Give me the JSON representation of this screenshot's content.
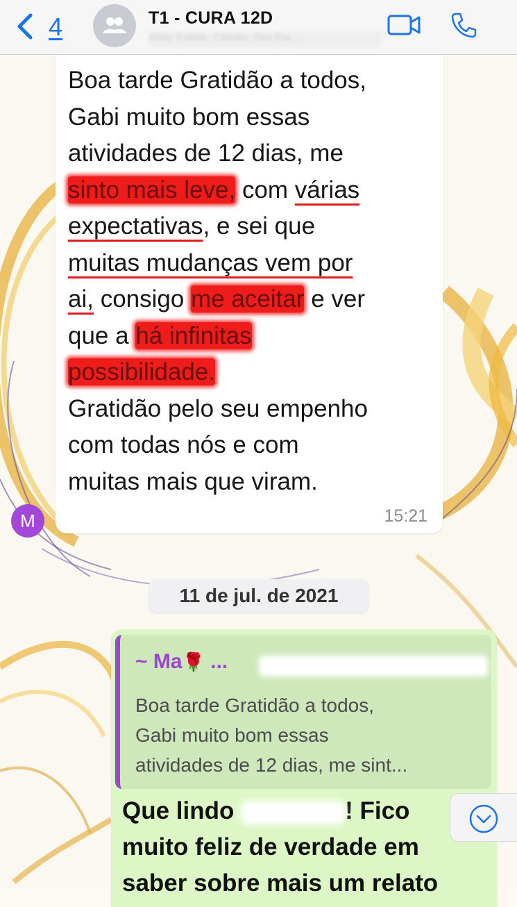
{
  "header": {
    "back_count": "4",
    "title": "T1 - CURA 12D",
    "subtitle": "Aline Fatele, Cliente, Dra Ga..."
  },
  "messages": [
    {
      "sender_initial": "M",
      "line1": "Boa tarde Gratidão a todos,",
      "line2": "Gabi muito bom essas",
      "line3": "atividades de 12 dias, me",
      "hl1": "sinto mais leve,",
      "line4b": " com ",
      "ul1": "várias",
      "ul2": "expectativas",
      "line5b": ", e sei que",
      "ul3": "muitas mudanças vem por",
      "ul4": "ai,",
      "line7b": "  consigo ",
      "hl2": "me aceitar",
      "line7c": " e ver",
      "line8a": "que a ",
      "hl3": "há infinitas",
      "hl4": "possibilidade.",
      "line10": "Gratidão pelo seu empenho",
      "line11": "com todas nós e com",
      "line12": "muitas mais que viram.",
      "time": "15:21"
    }
  ],
  "date_divider": "11 de jul. de 2021",
  "reply": {
    "quote_author": "~ Ma",
    "quote_author_suffix": "...",
    "quote_rose": "🌹",
    "quote_line1": "Boa tarde Gratidão a todos,",
    "quote_line2": "Gabi muito bom essas",
    "quote_line3": "atividades de 12 dias, me sint...",
    "text_a": "Que lindo ",
    "text_b": "! Fico",
    "text_line2": "muito feliz de verdade em",
    "text_line3": "saber sobre mais um relato"
  },
  "icons": {
    "back": "chevron-left-icon",
    "group": "group-icon",
    "video": "video-camera-icon",
    "call": "phone-icon",
    "scroll": "chevron-down-circle-icon"
  },
  "colors": {
    "link_blue": "#1a73e8",
    "highlight_red": "#ef1c1c",
    "quote_purple": "#9c45cd",
    "outgoing_bubble": "#dcf7c5"
  }
}
